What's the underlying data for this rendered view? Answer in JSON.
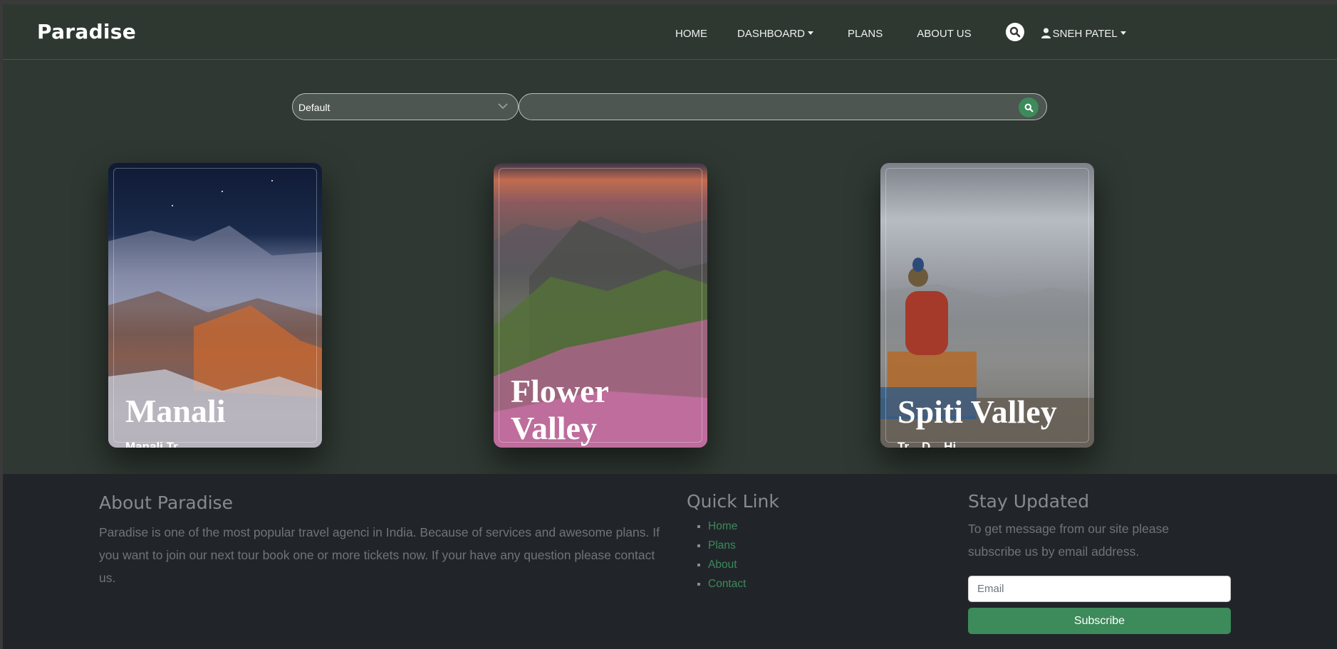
{
  "brand": "Paradise",
  "nav": {
    "home": "HOME",
    "dashboard": "DASHBOARD",
    "plans": "PLANS",
    "about": "ABOUT US",
    "user": "SNEH PATEL"
  },
  "search": {
    "select_value": "Default",
    "input_value": ""
  },
  "cards": [
    {
      "title": "Manali",
      "subtitle": "Manali Tr..."
    },
    {
      "title": "Flower Valley",
      "subtitle": ""
    },
    {
      "title": "Spiti Valley",
      "subtitle": "Tr... D... Hi..."
    }
  ],
  "footer": {
    "about_heading": "About Paradise",
    "about_text": "Paradise is one of the most popular travel agenci in India. Because of services and awesome plans. If you want to join our next tour book one or more tickets now. If your have any question please contact us.",
    "quick_heading": "Quick Link",
    "links": [
      "Home",
      "Plans",
      "About",
      "Contact"
    ],
    "stay_heading": "Stay Updated",
    "stay_text": "To get message from our site please subscribe us by email address.",
    "email_placeholder": "Email",
    "subscribe_label": "Subscribe"
  },
  "colors": {
    "accent": "#3d8a5b",
    "background": "#2f3832",
    "footer_bg": "#212529"
  }
}
